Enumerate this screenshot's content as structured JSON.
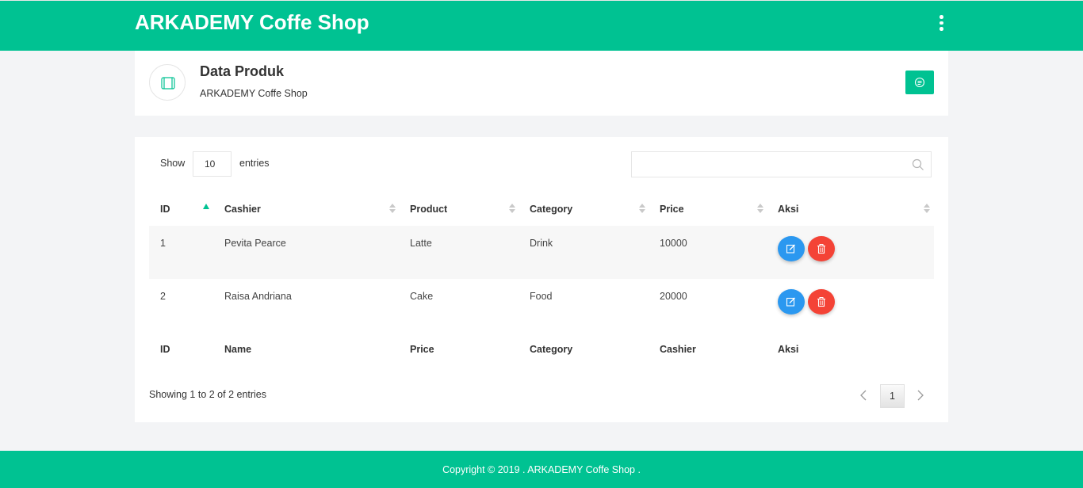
{
  "app": {
    "brand": "ARKADEMY Coffe Shop"
  },
  "header": {
    "title": "Data Produk",
    "subtitle": "ARKADEMY Coffe Shop"
  },
  "table": {
    "show_label": "Show",
    "page_length": "10",
    "entries_label": "entries",
    "search_value": "",
    "columns": [
      "ID",
      "Cashier",
      "Product",
      "Category",
      "Price",
      "Aksi"
    ],
    "rows": [
      {
        "id": "1",
        "cashier": "Pevita Pearce",
        "product": "Latte",
        "category": "Drink",
        "price": "10000"
      },
      {
        "id": "2",
        "cashier": "Raisa Andriana",
        "product": "Cake",
        "category": "Food",
        "price": "20000"
      }
    ],
    "footer_columns": [
      "ID",
      "Name",
      "Price",
      "Category",
      "Cashier",
      "Aksi"
    ],
    "info": "Showing 1 to 2 of 2 entries",
    "current_page": "1",
    "sorted_column": "ID",
    "sort_direction": "ascending"
  },
  "footer": {
    "copyright": "Copyright © 2019 . ARKADEMY Coffe Shop ."
  },
  "colors": {
    "primary": "#00c292",
    "edit": "#2b98f0",
    "delete": "#f44336"
  },
  "icons": {
    "menu": "kebab-menu-icon",
    "header": "device-icon",
    "header_button": "chat-icon",
    "search": "search-icon",
    "edit": "edit-icon",
    "delete": "trash-icon"
  }
}
